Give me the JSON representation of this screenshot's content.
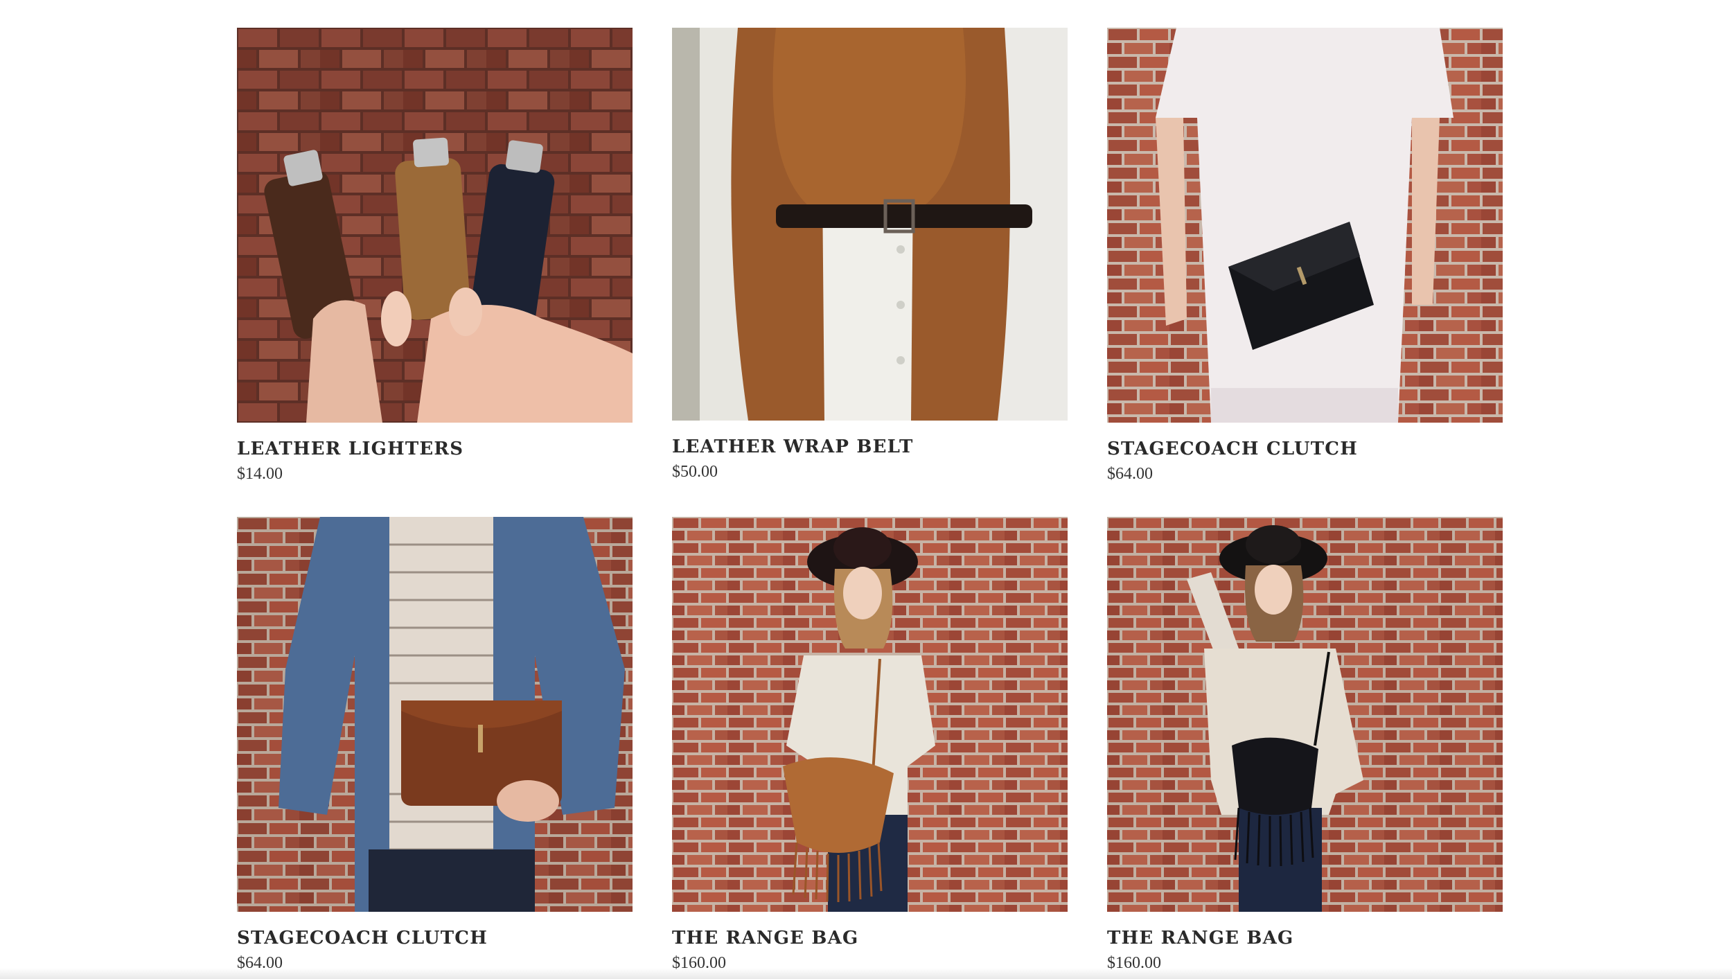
{
  "products": [
    {
      "name": "LEATHER LIGHTERS",
      "price": "$14.00",
      "image": "leather-lighters-photo"
    },
    {
      "name": "LEATHER WRAP BELT",
      "price": "$50.00",
      "image": "leather-wrap-belt-photo"
    },
    {
      "name": "STAGECOACH CLUTCH",
      "price": "$64.00",
      "image": "stagecoach-clutch-black-photo"
    },
    {
      "name": "STAGECOACH CLUTCH",
      "price": "$64.00",
      "image": "stagecoach-clutch-brown-photo"
    },
    {
      "name": "THE RANGE BAG",
      "price": "$160.00",
      "image": "range-bag-tan-photo"
    },
    {
      "name": "THE RANGE BAG",
      "price": "$160.00",
      "image": "range-bag-black-photo"
    }
  ],
  "colors": {
    "brick": "#8a4a3a",
    "brick_dark": "#5e2f25",
    "text": "#2a2a2a",
    "background": "#ffffff"
  }
}
